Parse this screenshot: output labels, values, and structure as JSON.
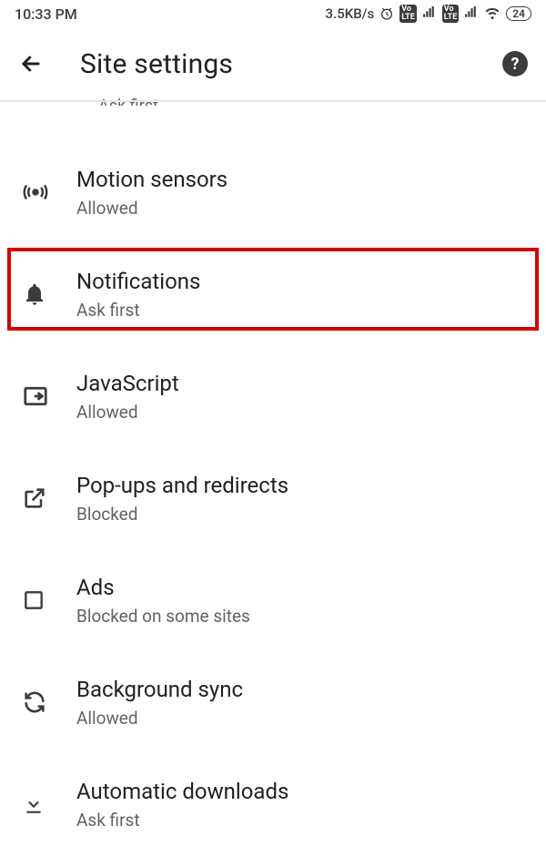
{
  "status": {
    "time": "10:33 PM",
    "speed": "3.5KB/s",
    "battery": "24",
    "volte": "Vo LTE"
  },
  "header": {
    "title": "Site settings",
    "help": "?"
  },
  "partial": {
    "sub": "Ask first"
  },
  "items": [
    {
      "title": "Motion sensors",
      "sub": "Allowed"
    },
    {
      "title": "Notifications",
      "sub": "Ask first"
    },
    {
      "title": "JavaScript",
      "sub": "Allowed"
    },
    {
      "title": "Pop-ups and redirects",
      "sub": "Blocked"
    },
    {
      "title": "Ads",
      "sub": "Blocked on some sites"
    },
    {
      "title": "Background sync",
      "sub": "Allowed"
    },
    {
      "title": "Automatic downloads",
      "sub": "Ask first"
    }
  ]
}
